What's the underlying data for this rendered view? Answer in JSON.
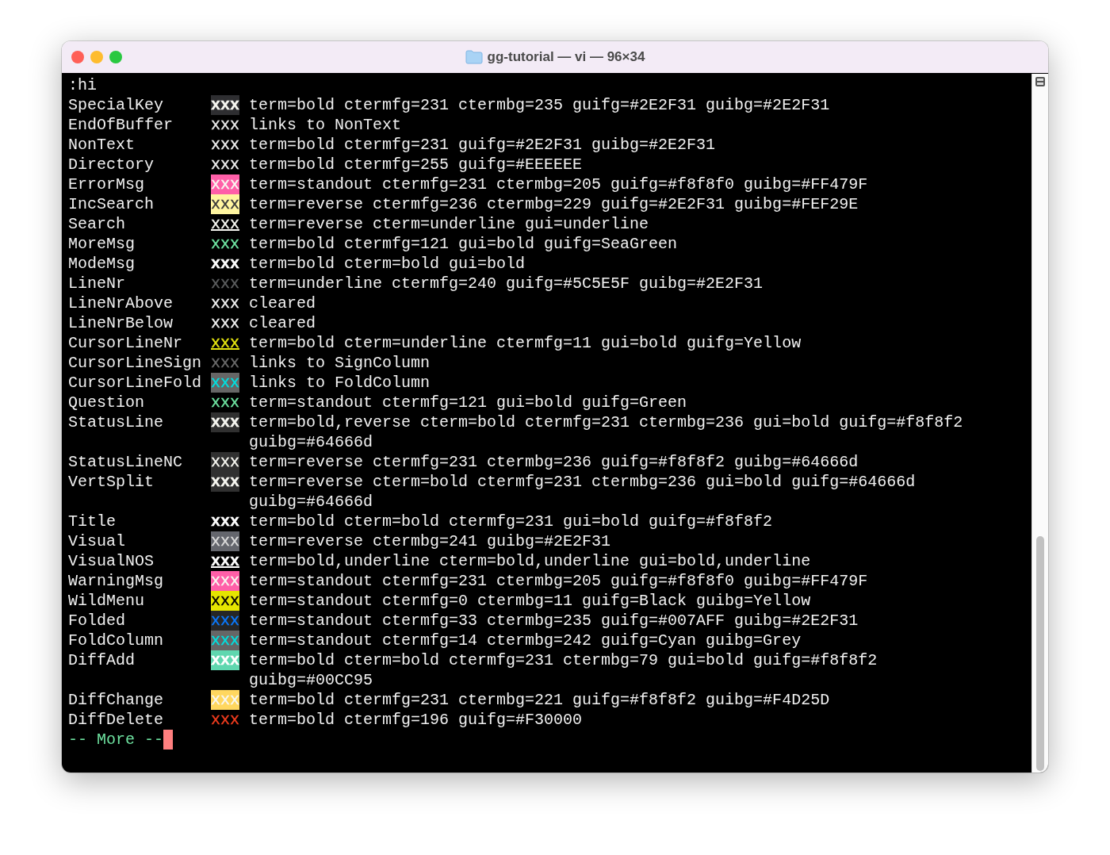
{
  "window": {
    "title": "gg-tutorial — vi — 96×34"
  },
  "command": ":hi",
  "rows": [
    {
      "name": "SpecialKey",
      "sample": {
        "text": "xxx",
        "color": "#f8f8f2",
        "bold": true,
        "underline": false,
        "highlight": {
          "color": "#2e2e31"
        }
      },
      "description": "term=bold ctermfg=231 ctermbg=235 guifg=#2E2F31 guibg=#2E2F31"
    },
    {
      "name": "EndOfBuffer",
      "sample": {
        "text": "xxx",
        "color": "#e8e8e8",
        "bold": false,
        "underline": false
      },
      "description": "links to NonText"
    },
    {
      "name": "NonText",
      "sample": {
        "text": "xxx",
        "color": "#eeeeee",
        "bold": false,
        "underline": false
      },
      "description": "term=bold ctermfg=231 guifg=#2E2F31 guibg=#2E2F31"
    },
    {
      "name": "Directory",
      "sample": {
        "text": "xxx",
        "color": "#eeeeee",
        "bold": false,
        "underline": false
      },
      "description": "term=bold ctermfg=255 guifg=#EEEEEE"
    },
    {
      "name": "ErrorMsg",
      "sample": {
        "text": "xxx",
        "color": "#f8f8f0",
        "bold": false,
        "underline": false,
        "highlight": {
          "color": "#ff5fa8"
        }
      },
      "description": "term=standout ctermfg=231 ctermbg=205 guifg=#f8f8f0 guibg=#FF479F"
    },
    {
      "name": "IncSearch",
      "sample": {
        "text": "xxx",
        "color": "#3a3a3a",
        "bold": false,
        "underline": false,
        "highlight": {
          "color": "#fff5a0"
        }
      },
      "description": "term=reverse ctermfg=236 ctermbg=229 guifg=#2E2F31 guibg=#FEF29E"
    },
    {
      "name": "Search",
      "sample": {
        "text": "xxx",
        "color": "#f8f8f2",
        "bold": false,
        "underline": true
      },
      "description": "term=reverse cterm=underline gui=underline"
    },
    {
      "name": "MoreMsg",
      "sample": {
        "text": "xxx",
        "color": "#6ee2a0",
        "bold": false,
        "underline": false
      },
      "description": "term=bold ctermfg=121 gui=bold guifg=SeaGreen"
    },
    {
      "name": "ModeMsg",
      "sample": {
        "text": "xxx",
        "color": "#ffffff",
        "bold": true,
        "underline": false
      },
      "description": "term=bold cterm=bold gui=bold"
    },
    {
      "name": "LineNr",
      "sample": {
        "text": "xxx",
        "color": "#5c5e5f",
        "bold": false,
        "underline": false
      },
      "description": "term=underline ctermfg=240 guifg=#5C5E5F guibg=#2E2F31"
    },
    {
      "name": "LineNrAbove",
      "sample": {
        "text": "xxx",
        "color": "#f0f0f0",
        "bold": false,
        "underline": false
      },
      "description": "cleared"
    },
    {
      "name": "LineNrBelow",
      "sample": {
        "text": "xxx",
        "color": "#f0f0f0",
        "bold": false,
        "underline": false
      },
      "description": "cleared"
    },
    {
      "name": "CursorLineNr",
      "sample": {
        "text": "xxx",
        "color": "#e5e510",
        "bold": false,
        "underline": true
      },
      "description": "term=bold cterm=underline ctermfg=11 gui=bold guifg=Yellow"
    },
    {
      "name": "CursorLineSign",
      "sample": {
        "text": "xxx",
        "color": "#6a6a6a",
        "bold": false,
        "underline": false
      },
      "description": "links to SignColumn"
    },
    {
      "name": "CursorLineFold",
      "sample": {
        "text": "xxx",
        "color": "#00e0e0",
        "bold": false,
        "underline": false,
        "highlight": {
          "color": "#666666"
        }
      },
      "description": "links to FoldColumn"
    },
    {
      "name": "Question",
      "sample": {
        "text": "xxx",
        "color": "#6ee2a0",
        "bold": false,
        "underline": false
      },
      "description": "term=standout ctermfg=121 gui=bold guifg=Green"
    },
    {
      "name": "StatusLine",
      "sample": {
        "text": "xxx",
        "color": "#f8f8f2",
        "bold": true,
        "underline": false,
        "highlight": {
          "color": "#303030"
        }
      },
      "description": "term=bold,reverse cterm=bold ctermfg=231 ctermbg=236 gui=bold guifg=#f8f8f2 guibg=#64666d"
    },
    {
      "name": "StatusLineNC",
      "sample": {
        "text": "xxx",
        "color": "#f8f8f2",
        "bold": false,
        "underline": false,
        "highlight": {
          "color": "#303030"
        }
      },
      "description": "term=reverse ctermfg=231 ctermbg=236 guifg=#f8f8f2 guibg=#64666d"
    },
    {
      "name": "VertSplit",
      "sample": {
        "text": "xxx",
        "color": "#f8f8f2",
        "bold": true,
        "underline": false,
        "highlight": {
          "color": "#303030"
        }
      },
      "description": "term=reverse cterm=bold ctermfg=231 ctermbg=236 gui=bold guifg=#64666d guibg=#64666d"
    },
    {
      "name": "Title",
      "sample": {
        "text": "xxx",
        "color": "#ffffff",
        "bold": true,
        "underline": false
      },
      "description": "term=bold cterm=bold ctermfg=231 gui=bold guifg=#f8f8f2"
    },
    {
      "name": "Visual",
      "sample": {
        "text": "xxx",
        "color": "#dcdcdc",
        "bold": false,
        "underline": false,
        "highlight": {
          "color": "#64666d"
        }
      },
      "description": "term=reverse ctermbg=241 guibg=#2E2F31"
    },
    {
      "name": "VisualNOS",
      "sample": {
        "text": "xxx",
        "color": "#ffffff",
        "bold": true,
        "underline": true
      },
      "description": "term=bold,underline cterm=bold,underline gui=bold,underline"
    },
    {
      "name": "WarningMsg",
      "sample": {
        "text": "xxx",
        "color": "#f8f8f0",
        "bold": false,
        "underline": false,
        "highlight": {
          "color": "#ff5fa8"
        }
      },
      "description": "term=standout ctermfg=231 ctermbg=205 guifg=#f8f8f0 guibg=#FF479F"
    },
    {
      "name": "WildMenu",
      "sample": {
        "text": "xxx",
        "color": "#000000",
        "bold": false,
        "underline": false,
        "highlight": {
          "color": "#e5e500"
        }
      },
      "description": "term=standout ctermfg=0 ctermbg=11 guifg=Black guibg=Yellow"
    },
    {
      "name": "Folded",
      "sample": {
        "text": "xxx",
        "color": "#0a7aff",
        "bold": false,
        "underline": false,
        "highlight": {
          "color": "#262626"
        }
      },
      "description": "term=standout ctermfg=33 ctermbg=235 guifg=#007AFF guibg=#2E2F31"
    },
    {
      "name": "FoldColumn",
      "sample": {
        "text": "xxx",
        "color": "#00e0e0",
        "bold": false,
        "underline": false,
        "highlight": {
          "color": "#666666"
        }
      },
      "description": "term=standout ctermfg=14 ctermbg=242 guifg=Cyan guibg=Grey"
    },
    {
      "name": "DiffAdd",
      "sample": {
        "text": "xxx",
        "color": "#ffffff",
        "bold": true,
        "underline": false,
        "highlight": {
          "color": "#5fd7af"
        }
      },
      "description": "term=bold cterm=bold ctermfg=231 ctermbg=79 gui=bold guifg=#f8f8f2 guibg=#00CC95"
    },
    {
      "name": "DiffChange",
      "sample": {
        "text": "xxx",
        "color": "#f8f8f2",
        "bold": false,
        "underline": false,
        "highlight": {
          "color": "#ffd75f"
        }
      },
      "description": "term=bold ctermfg=231 ctermbg=221 guifg=#f8f8f2 guibg=#F4D25D"
    },
    {
      "name": "DiffDelete",
      "sample": {
        "text": "xxx",
        "color": "#f03c1e",
        "bold": false,
        "underline": false
      },
      "description": "term=bold ctermfg=196 guifg=#F30000"
    }
  ],
  "more_prompt": "-- More --"
}
